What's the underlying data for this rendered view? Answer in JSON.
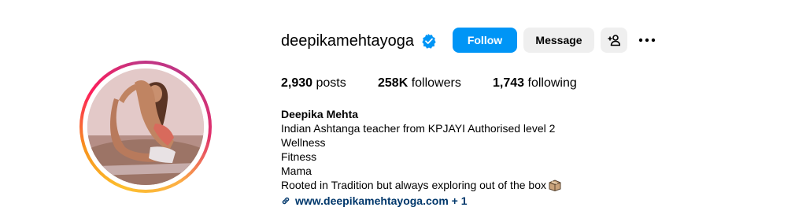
{
  "profile": {
    "username": "deepikamehtayoga",
    "verified_icon": "verified-badge-icon",
    "follow_label": "Follow",
    "message_label": "Message",
    "suggest_icon": "add-person-icon",
    "more_icon": "more-options-icon",
    "avatar": "profile-photo-yoga-pose"
  },
  "stats": {
    "posts_count": "2,930",
    "posts_label": "posts",
    "followers_count": "258K",
    "followers_label": "followers",
    "following_count": "1,743",
    "following_label": "following"
  },
  "bio": {
    "full_name": "Deepika Mehta",
    "lines": [
      "Indian Ashtanga teacher from KPJAYI Authorised level 2",
      "Wellness",
      "Fitness",
      "Mama",
      "Rooted in Tradition but always exploring out of the box"
    ],
    "emoji_icon": "package-box-icon",
    "link_text": "www.deepikamehtayoga.com",
    "link_extra": "+ 1"
  },
  "colors": {
    "accent_blue": "#0095f6",
    "link_color": "#00376b",
    "button_gray": "#efefef"
  }
}
